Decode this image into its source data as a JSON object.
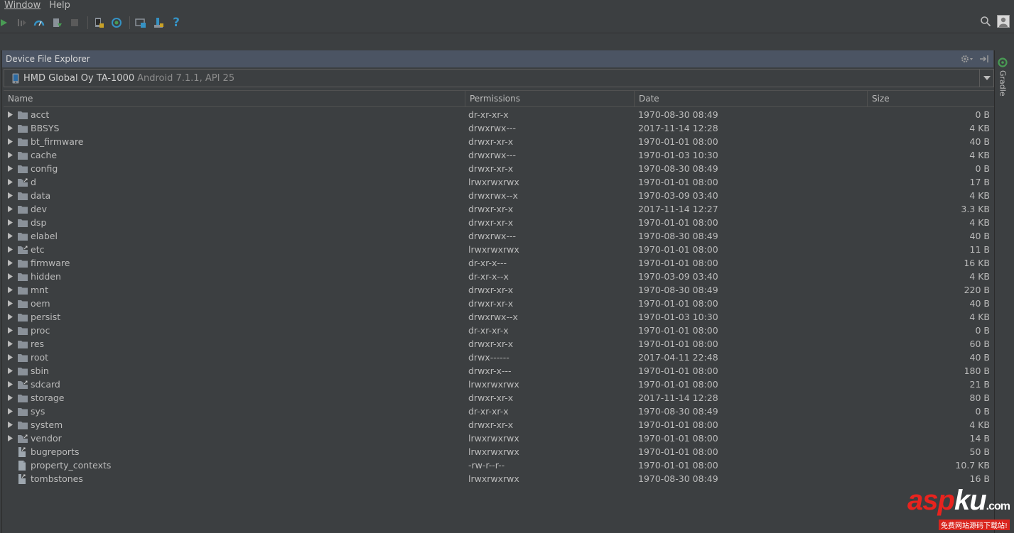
{
  "menu": {
    "items": [
      "Window",
      "Help"
    ]
  },
  "toolbar": {
    "icons": [
      "run-icon",
      "debug-icon",
      "profile-icon",
      "apply-changes-icon",
      "stop-icon",
      "avd-manager-icon",
      "sync-icon",
      "device-manager-icon",
      "sdk-manager-icon",
      "help-icon"
    ],
    "help_label": "?"
  },
  "panel": {
    "title": "Device File Explorer"
  },
  "device": {
    "name": "HMD Global Oy TA-1000",
    "api": "Android 7.1.1, API 25"
  },
  "table": {
    "columns": [
      "Name",
      "Permissions",
      "Date",
      "Size"
    ],
    "rows": [
      {
        "name": "acct",
        "perm": "dr-xr-xr-x",
        "date": "1970-08-30 08:49",
        "size": "0 B",
        "type": "folder"
      },
      {
        "name": "BBSYS",
        "perm": "drwxrwx---",
        "date": "2017-11-14 12:28",
        "size": "4 KB",
        "type": "folder"
      },
      {
        "name": "bt_firmware",
        "perm": "drwxr-xr-x",
        "date": "1970-01-01 08:00",
        "size": "40 B",
        "type": "folder"
      },
      {
        "name": "cache",
        "perm": "drwxrwx---",
        "date": "1970-01-03 10:30",
        "size": "4 KB",
        "type": "folder"
      },
      {
        "name": "config",
        "perm": "drwxr-xr-x",
        "date": "1970-08-30 08:49",
        "size": "0 B",
        "type": "folder"
      },
      {
        "name": "d",
        "perm": "lrwxrwxrwx",
        "date": "1970-01-01 08:00",
        "size": "17 B",
        "type": "link-folder"
      },
      {
        "name": "data",
        "perm": "drwxrwx--x",
        "date": "1970-03-09 03:40",
        "size": "4 KB",
        "type": "folder"
      },
      {
        "name": "dev",
        "perm": "drwxr-xr-x",
        "date": "2017-11-14 12:27",
        "size": "3.3 KB",
        "type": "folder"
      },
      {
        "name": "dsp",
        "perm": "drwxr-xr-x",
        "date": "1970-01-01 08:00",
        "size": "4 KB",
        "type": "folder"
      },
      {
        "name": "elabel",
        "perm": "drwxrwx---",
        "date": "1970-08-30 08:49",
        "size": "40 B",
        "type": "folder"
      },
      {
        "name": "etc",
        "perm": "lrwxrwxrwx",
        "date": "1970-01-01 08:00",
        "size": "11 B",
        "type": "link-folder"
      },
      {
        "name": "firmware",
        "perm": "dr-xr-x---",
        "date": "1970-01-01 08:00",
        "size": "16 KB",
        "type": "folder"
      },
      {
        "name": "hidden",
        "perm": "dr-xr-x--x",
        "date": "1970-03-09 03:40",
        "size": "4 KB",
        "type": "folder"
      },
      {
        "name": "mnt",
        "perm": "drwxr-xr-x",
        "date": "1970-08-30 08:49",
        "size": "220 B",
        "type": "folder"
      },
      {
        "name": "oem",
        "perm": "drwxr-xr-x",
        "date": "1970-01-01 08:00",
        "size": "40 B",
        "type": "folder"
      },
      {
        "name": "persist",
        "perm": "drwxrwx--x",
        "date": "1970-01-03 10:30",
        "size": "4 KB",
        "type": "folder"
      },
      {
        "name": "proc",
        "perm": "dr-xr-xr-x",
        "date": "1970-01-01 08:00",
        "size": "0 B",
        "type": "folder"
      },
      {
        "name": "res",
        "perm": "drwxr-xr-x",
        "date": "1970-01-01 08:00",
        "size": "60 B",
        "type": "folder"
      },
      {
        "name": "root",
        "perm": "drwx------",
        "date": "2017-04-11 22:48",
        "size": "40 B",
        "type": "folder"
      },
      {
        "name": "sbin",
        "perm": "drwxr-x---",
        "date": "1970-01-01 08:00",
        "size": "180 B",
        "type": "folder"
      },
      {
        "name": "sdcard",
        "perm": "lrwxrwxrwx",
        "date": "1970-01-01 08:00",
        "size": "21 B",
        "type": "link-folder"
      },
      {
        "name": "storage",
        "perm": "drwxr-xr-x",
        "date": "2017-11-14 12:28",
        "size": "80 B",
        "type": "folder"
      },
      {
        "name": "sys",
        "perm": "dr-xr-xr-x",
        "date": "1970-08-30 08:49",
        "size": "0 B",
        "type": "folder"
      },
      {
        "name": "system",
        "perm": "drwxr-xr-x",
        "date": "1970-01-01 08:00",
        "size": "4 KB",
        "type": "folder"
      },
      {
        "name": "vendor",
        "perm": "lrwxrwxrwx",
        "date": "1970-01-01 08:00",
        "size": "14 B",
        "type": "link-folder"
      },
      {
        "name": "bugreports",
        "perm": "lrwxrwxrwx",
        "date": "1970-01-01 08:00",
        "size": "50 B",
        "type": "link-file"
      },
      {
        "name": "property_contexts",
        "perm": "-rw-r--r--",
        "date": "1970-01-01 08:00",
        "size": "10.7 KB",
        "type": "file"
      },
      {
        "name": "tombstones",
        "perm": "lrwxrwxrwx",
        "date": "1970-08-30 08:49",
        "size": "16 B",
        "type": "link-file"
      }
    ]
  },
  "gutter": {
    "gradle_label": "Gradle"
  },
  "watermark": {
    "logo_a": "asp",
    "logo_b": "ku",
    "logo_dot": ".com",
    "subtitle": "免费网站源码下载站!"
  },
  "colors": {
    "folder": "#8a9199",
    "accent_blue": "#3592c4",
    "accent_green": "#499c54",
    "header_bg": "#4b5463"
  }
}
